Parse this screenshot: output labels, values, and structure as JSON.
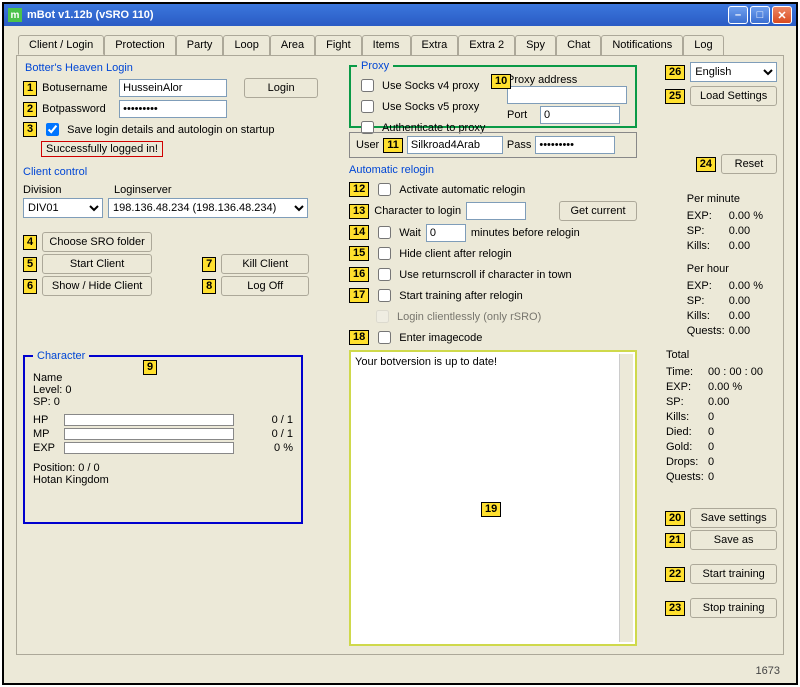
{
  "window": {
    "title": "mBot v1.12b (vSRO 110)"
  },
  "tabs": [
    "Client / Login",
    "Protection",
    "Party",
    "Loop",
    "Area",
    "Fight",
    "Items",
    "Extra",
    "Extra 2",
    "Spy",
    "Chat",
    "Notifications",
    "Log"
  ],
  "login": {
    "legend": "Botter's Heaven Login",
    "userLabel": "Botusername",
    "userValue": "HusseinAlor",
    "passLabel": "Botpassword",
    "passValue": "•••••••••",
    "loginBtn": "Login",
    "saveChk": "Save login details and autologin on startup",
    "statusMsg": "Successfully logged in!"
  },
  "clientControl": {
    "legend": "Client control",
    "divisionLabel": "Division",
    "divisionValue": "DIV01",
    "loginserverLabel": "Loginserver",
    "loginserverValue": "198.136.48.234 (198.136.48.234)",
    "chooseFolder": "Choose SRO folder",
    "startClient": "Start Client",
    "showHide": "Show / Hide Client",
    "killClient": "Kill Client",
    "logOff": "Log Off"
  },
  "proxy": {
    "legend": "Proxy",
    "socks4": "Use Socks v4 proxy",
    "socks5": "Use Socks v5 proxy",
    "auth": "Authenticate to proxy",
    "addrLabel": "Proxy address",
    "addrValue": "",
    "portLabel": "Port",
    "portValue": "0",
    "userLabel": "User",
    "userValue": "Silkroad4Arab",
    "passLabel": "Pass",
    "passValue": "•••••••••"
  },
  "relogin": {
    "legend": "Automatic relogin",
    "activate": "Activate automatic relogin",
    "charLabel": "Character to login",
    "getCurrent": "Get current",
    "waitLbl": "Wait",
    "waitVal": "0",
    "waitSuffix": "minutes before relogin",
    "hideAfter": "Hide client after relogin",
    "returnScroll": "Use returnscroll if character in town",
    "startTraining": "Start training after relogin",
    "clientless": "Login clientlessly (only rSRO)",
    "imagecode": "Enter imagecode"
  },
  "logbox": {
    "text": "Your botversion is up to date!"
  },
  "character": {
    "legend": "Character",
    "name": "Name",
    "level": "Level: 0",
    "sp": "SP: 0",
    "hpLabel": "HP",
    "hpVal": "0 / 1",
    "mpLabel": "MP",
    "mpVal": "0 / 1",
    "expLabel": "EXP",
    "expVal": "0 %",
    "pos": "Position: 0 / 0",
    "region": "Hotan Kingdom"
  },
  "right": {
    "language": "English",
    "loadSettings": "Load Settings",
    "reset": "Reset",
    "perMinute": "Per minute",
    "perHour": "Per hour",
    "total": "Total",
    "expL": "EXP:",
    "expV": "0.00 %",
    "spL": "SP:",
    "spV": "0.00",
    "killsL": "Kills:",
    "killsV": "0.00",
    "expHV": "0.00 %",
    "spHV": "0.00",
    "killsHV": "0.00",
    "questsL": "Quests:",
    "questsHV": "0.00",
    "timeL": "Time:",
    "timeV": "00 : 00 : 00",
    "expTV": "0.00 %",
    "spTV": "0.00",
    "killsTV": "0",
    "diedL": "Died:",
    "diedV": "0",
    "goldL": "Gold:",
    "goldV": "0",
    "dropsL": "Drops:",
    "dropsV": "0",
    "questsTV": "0",
    "saveSettings": "Save settings",
    "saveAs": "Save as",
    "startTraining": "Start training",
    "stopTraining": "Stop training"
  },
  "status": {
    "num": "1673"
  },
  "annotations": {
    "1": "1",
    "2": "2",
    "3": "3",
    "4": "4",
    "5": "5",
    "6": "6",
    "7": "7",
    "8": "8",
    "9": "9",
    "10": "10",
    "11": "11",
    "12": "12",
    "13": "13",
    "14": "14",
    "15": "15",
    "16": "16",
    "17": "17",
    "18": "18",
    "19": "19",
    "20": "20",
    "21": "21",
    "22": "22",
    "23": "23",
    "24": "24",
    "25": "25",
    "26": "26"
  }
}
